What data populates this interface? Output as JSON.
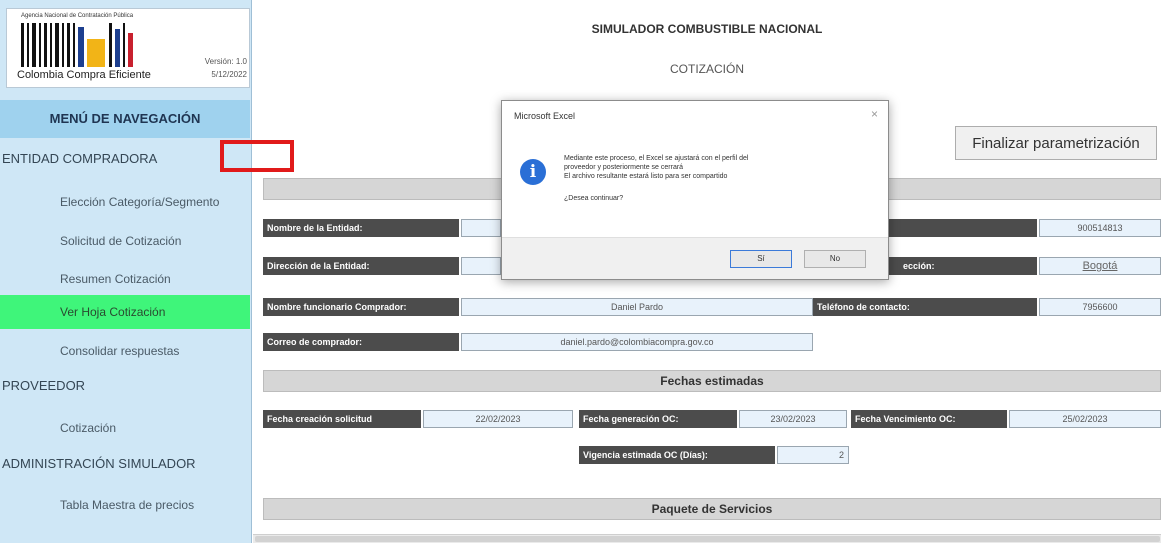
{
  "sidebar": {
    "logo": {
      "agency": "Agencia Nacional de Contratación Pública",
      "brand": "Colombia Compra Eficiente",
      "version": "Versión: 1.0",
      "date": "5/12/2022"
    },
    "nav_title": "MENÚ DE NAVEGACIÓN",
    "sections": [
      {
        "label": "ENTIDAD COMPRADORA",
        "items": [
          {
            "label": "Elección Categoría/Segmento",
            "active": false
          },
          {
            "label": "Solicitud de Cotización",
            "active": false
          },
          {
            "label": "Resumen Cotización",
            "active": false
          },
          {
            "label": "Ver Hoja Cotización",
            "active": true
          },
          {
            "label": "Consolidar respuestas",
            "active": false
          }
        ]
      },
      {
        "label": "PROVEEDOR",
        "items": [
          {
            "label": "Cotización",
            "active": false
          }
        ]
      },
      {
        "label": "ADMINISTRACIÓN SIMULADOR",
        "items": [
          {
            "label": "Tabla Maestra de precios",
            "active": false
          }
        ]
      }
    ]
  },
  "main": {
    "app_title": "SIMULADOR COMBUSTIBLE NACIONAL",
    "sheet_title": "COTIZACIÓN",
    "finalize_button": "Finalizar parametrización",
    "fields": {
      "entity_name_label": "Nombre de la Entidad:",
      "entity_nit_value": "900514813",
      "entity_address_label": "Dirección de la Entidad:",
      "city_label_fragment": "ección:",
      "city_value": "Bogotá",
      "buyer_name_label": "Nombre funcionario Comprador:",
      "buyer_name_value": "Daniel Pardo",
      "phone_label": "Teléfono de contacto:",
      "phone_value": "7956600",
      "buyer_email_label": "Correo de comprador:",
      "buyer_email_value": "daniel.pardo@colombiacompra.gov.co"
    },
    "dates": {
      "section_title": "Fechas estimadas",
      "request_creation_label": "Fecha creación solicitud",
      "request_creation_value": "22/02/2023",
      "oc_generation_label": "Fecha generación OC:",
      "oc_generation_value": "23/02/2023",
      "oc_expiry_label": "Fecha Vencimiento OC:",
      "oc_expiry_value": "25/02/2023",
      "validity_label": "Vigencia estimada OC (Días):",
      "validity_value": "2"
    },
    "services_title": "Paquete de Servicios"
  },
  "dialog": {
    "title": "Microsoft Excel",
    "close_glyph": "×",
    "icon_glyph": "i",
    "message_lines": [
      "Mediante este proceso, el Excel se ajustará con el perfil del",
      "proveedor y posteriormente se cerrará",
      "El archivo resultante estará listo para ser compartido"
    ],
    "question": "¿Desea continuar?",
    "yes_label": "Sí",
    "no_label": "No"
  },
  "colors": {
    "sidebar_bg": "#cfe7f6",
    "nav_title_bg": "#9fd2ee",
    "active_item_bg": "#3ff57a",
    "label_bg": "#4c4c4c",
    "highlight": "#e11a1a",
    "info_icon": "#2a6fd6"
  }
}
